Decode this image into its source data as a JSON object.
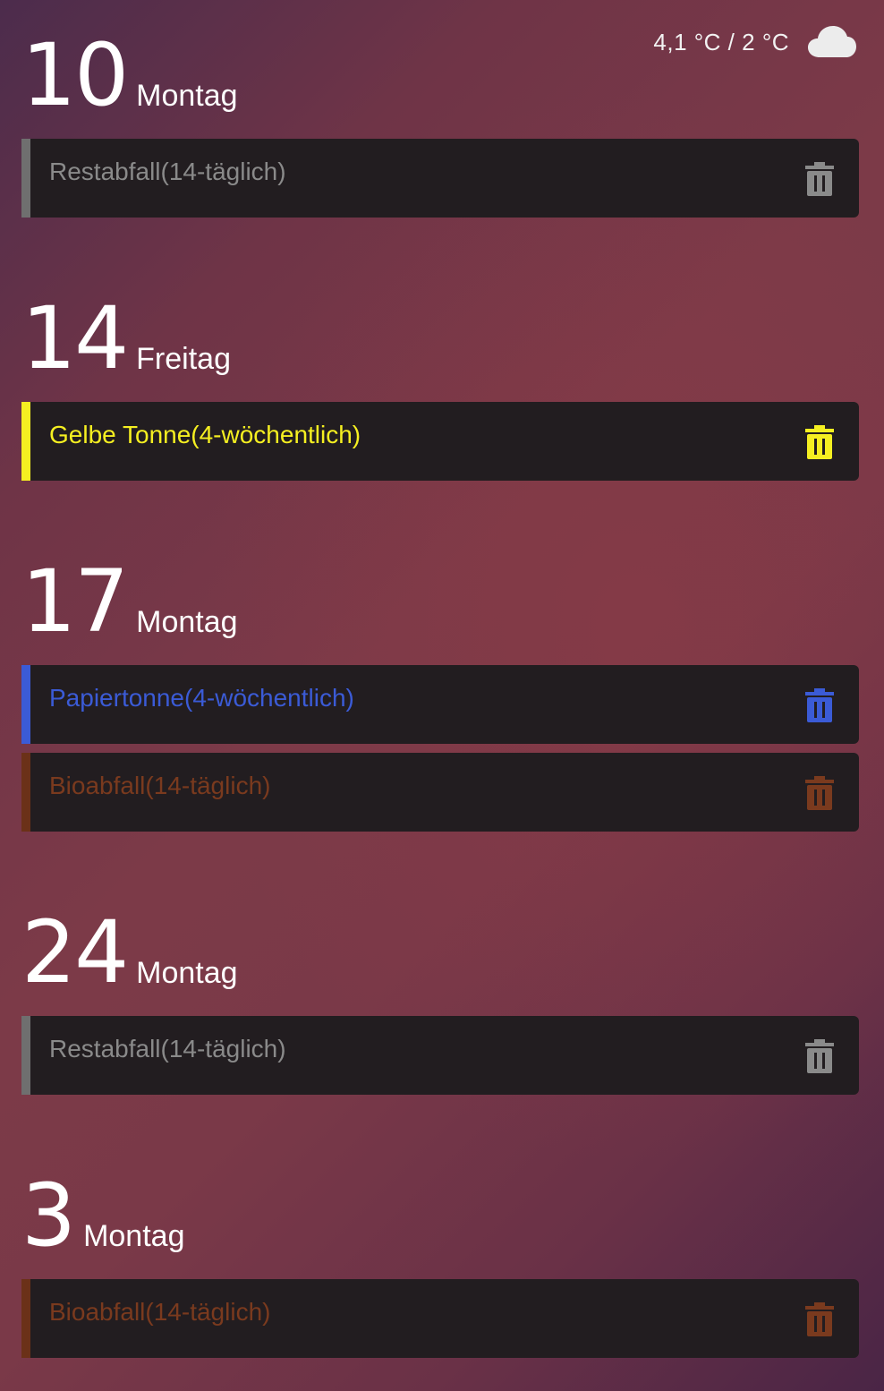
{
  "weather": {
    "temperature_text": "4,1 °C / 2 °C",
    "icon": "cloud-icon"
  },
  "days": [
    {
      "day_number": "10",
      "weekday": "Montag",
      "events": [
        {
          "label": "Restabfall(14-täglich)",
          "color": "#8a8a8a",
          "bar_color": "#6f6f6f",
          "icon": "trash-icon"
        }
      ]
    },
    {
      "day_number": "14",
      "weekday": "Freitag",
      "events": [
        {
          "label": "Gelbe Tonne(4-wöchentlich)",
          "color": "#f5ef21",
          "bar_color": "#f5ef21",
          "icon": "trash-icon"
        }
      ]
    },
    {
      "day_number": "17",
      "weekday": "Montag",
      "events": [
        {
          "label": "Papiertonne(4-wöchentlich)",
          "color": "#3b5bd6",
          "bar_color": "#3b5bd6",
          "icon": "trash-icon"
        },
        {
          "label": "Bioabfall(14-täglich)",
          "color": "#7a3a1e",
          "bar_color": "#6b3118",
          "icon": "trash-icon"
        }
      ]
    },
    {
      "day_number": "24",
      "weekday": "Montag",
      "events": [
        {
          "label": "Restabfall(14-täglich)",
          "color": "#8a8a8a",
          "bar_color": "#6f6f6f",
          "icon": "trash-icon"
        }
      ]
    },
    {
      "day_number": "3",
      "weekday": "Montag",
      "events": [
        {
          "label": "Bioabfall(14-täglich)",
          "color": "#7a3a1e",
          "bar_color": "#6b3118",
          "icon": "trash-icon"
        }
      ]
    }
  ]
}
